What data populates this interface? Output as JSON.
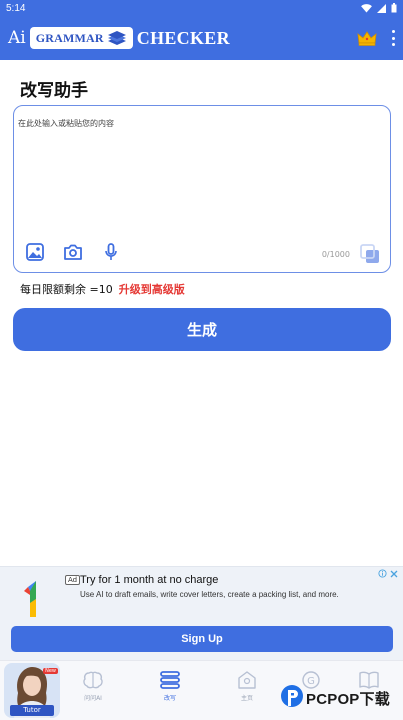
{
  "status_bar": {
    "time": "5:14"
  },
  "header": {
    "logo_ai": "Ai",
    "logo_grammar": "GRAMMAR",
    "logo_checker": "CHECKER"
  },
  "page": {
    "title": "改写助手"
  },
  "editor": {
    "placeholder": "在此处输入或粘贴您的内容",
    "char_count": "0/1000",
    "tools": [
      "image-icon",
      "camera-icon",
      "microphone-icon"
    ]
  },
  "quota": {
    "text": "每日限额剩余 =10",
    "upgrade_label": "升级到高级版"
  },
  "generate_label": "生成",
  "ad": {
    "badge": "Ad",
    "title": "Try for 1 month at no charge",
    "description": "Use AI to draft emails, write cover letters, create a packing list, and more.",
    "cta": "Sign Up"
  },
  "tutor": {
    "badge": "New",
    "label": "Tutor"
  },
  "bottom_nav": {
    "items": [
      {
        "label": "问问AI",
        "icon": "brain-icon"
      },
      {
        "label": "改写",
        "icon": "rewrite-icon"
      },
      {
        "label": "主页",
        "icon": "home-icon"
      },
      {
        "label": "",
        "icon": "grammar-check-icon"
      },
      {
        "label": "",
        "icon": "dictionary-icon"
      }
    ],
    "active_index": 1
  },
  "watermark": {
    "brand": "PCPOP下载"
  },
  "colors": {
    "primary": "#3f6ee0",
    "accent_red": "#e53935"
  }
}
